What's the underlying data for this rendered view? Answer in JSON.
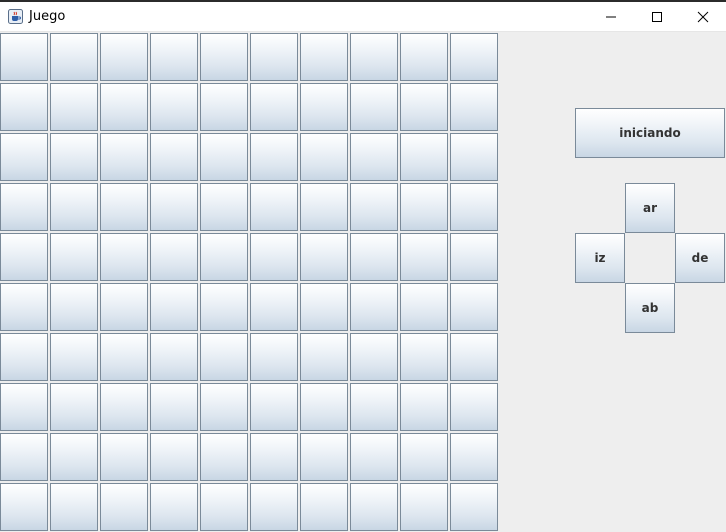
{
  "window": {
    "title": "Juego",
    "icon": "java-cup-icon",
    "controls": [
      "minimize-icon",
      "maximize-icon",
      "close-icon"
    ]
  },
  "board": {
    "rows": 10,
    "cols": 10
  },
  "controls": {
    "start_label": "iniciando",
    "up_label": "ar",
    "left_label": "iz",
    "right_label": "de",
    "down_label": "ab"
  },
  "colors": {
    "window_bg": "#eeeeee",
    "button_border": "#7a8a99",
    "button_text": "#333333"
  }
}
